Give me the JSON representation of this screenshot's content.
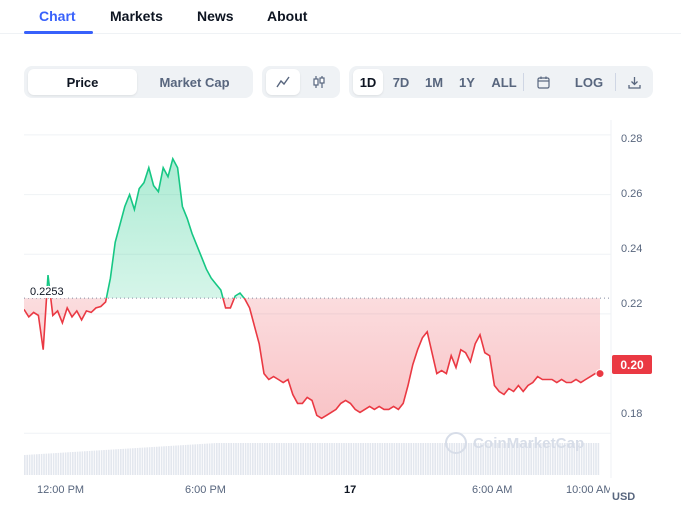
{
  "tabs": [
    {
      "label": "Chart",
      "active": true
    },
    {
      "label": "Markets",
      "active": false
    },
    {
      "label": "News",
      "active": false
    },
    {
      "label": "About",
      "active": false
    }
  ],
  "toolbar": {
    "metric_options": [
      "Price",
      "Market Cap"
    ],
    "metric_selected": "Price",
    "chart_style": {
      "selected": "line",
      "icons": [
        "line-chart-icon",
        "candlestick-icon"
      ]
    },
    "ranges": [
      "1D",
      "7D",
      "1M",
      "1Y",
      "ALL"
    ],
    "range_selected": "1D",
    "calendar_icon": "calendar-icon",
    "log_label": "LOG",
    "download_icon": "download-icon"
  },
  "chart_data": {
    "type": "area",
    "baseline": 0.2253,
    "baseline_label": "0.2253",
    "current_price_label": "0.20",
    "currency": "USD",
    "watermark": "CoinMarketCap",
    "up_color": "#16c784",
    "down_color": "#ea3943",
    "yticks": [
      "0.28",
      "0.26",
      "0.24",
      "0.22",
      "0.18"
    ],
    "ylim": [
      0.165,
      0.285
    ],
    "xticks": [
      "12:00 PM",
      "6:00 PM",
      "17",
      "6:00 AM",
      "10:00 AM"
    ],
    "x": [
      0,
      0.2,
      0.4,
      0.6,
      0.8,
      1.0,
      1.2,
      1.4,
      1.6,
      1.8,
      2.0,
      2.2,
      2.4,
      2.6,
      2.8,
      3.0,
      3.2,
      3.4,
      3.6,
      3.8,
      4.0,
      4.2,
      4.4,
      4.6,
      4.8,
      5.0,
      5.2,
      5.4,
      5.6,
      5.8,
      6.0,
      6.2,
      6.4,
      6.6,
      6.8,
      7.0,
      7.2,
      7.4,
      7.6,
      7.8,
      8.0,
      8.2,
      8.4,
      8.6,
      8.8,
      9.0,
      9.2,
      9.4,
      9.6,
      9.8,
      10.0,
      10.2,
      10.4,
      10.6,
      10.8,
      11.0,
      11.2,
      11.4,
      11.6,
      11.8,
      12.0,
      12.2,
      12.4,
      12.6,
      12.8,
      13.0,
      13.2,
      13.4,
      13.6,
      13.8,
      14.0,
      14.2,
      14.4,
      14.6,
      14.8,
      15.0,
      15.2,
      15.4,
      15.6,
      15.8,
      16.0,
      16.2,
      16.4,
      16.6,
      16.8,
      17.0,
      17.2,
      17.4,
      17.6,
      17.8,
      18.0,
      18.2,
      18.4,
      18.6,
      18.8,
      19.0,
      19.2,
      19.4,
      19.6,
      19.8,
      20.0,
      20.2,
      20.4,
      20.6,
      20.8,
      21.0,
      21.2,
      21.4,
      21.6,
      21.8,
      22.0,
      22.2,
      22.4,
      22.6,
      22.8,
      23.0,
      23.2,
      23.4,
      23.6,
      23.8,
      24.0
    ],
    "y": [
      0.2215,
      0.219,
      0.2205,
      0.2195,
      0.208,
      0.233,
      0.2195,
      0.221,
      0.217,
      0.222,
      0.219,
      0.221,
      0.218,
      0.221,
      0.2205,
      0.222,
      0.2225,
      0.224,
      0.232,
      0.244,
      0.25,
      0.256,
      0.26,
      0.255,
      0.262,
      0.264,
      0.269,
      0.263,
      0.261,
      0.269,
      0.266,
      0.272,
      0.269,
      0.256,
      0.252,
      0.247,
      0.243,
      0.239,
      0.235,
      0.232,
      0.23,
      0.228,
      0.222,
      0.222,
      0.226,
      0.227,
      0.225,
      0.222,
      0.216,
      0.21,
      0.2,
      0.198,
      0.199,
      0.198,
      0.197,
      0.198,
      0.193,
      0.19,
      0.19,
      0.192,
      0.191,
      0.186,
      0.185,
      0.186,
      0.187,
      0.188,
      0.19,
      0.191,
      0.19,
      0.188,
      0.187,
      0.188,
      0.189,
      0.188,
      0.189,
      0.188,
      0.188,
      0.189,
      0.188,
      0.19,
      0.196,
      0.203,
      0.208,
      0.212,
      0.214,
      0.207,
      0.2,
      0.201,
      0.2,
      0.206,
      0.202,
      0.208,
      0.207,
      0.204,
      0.21,
      0.213,
      0.207,
      0.206,
      0.196,
      0.194,
      0.193,
      0.195,
      0.194,
      0.196,
      0.194,
      0.196,
      0.197,
      0.199,
      0.198,
      0.198,
      0.198,
      0.197,
      0.198,
      0.197,
      0.197,
      0.198,
      0.197,
      0.198,
      0.199,
      0.2,
      0.2
    ]
  }
}
